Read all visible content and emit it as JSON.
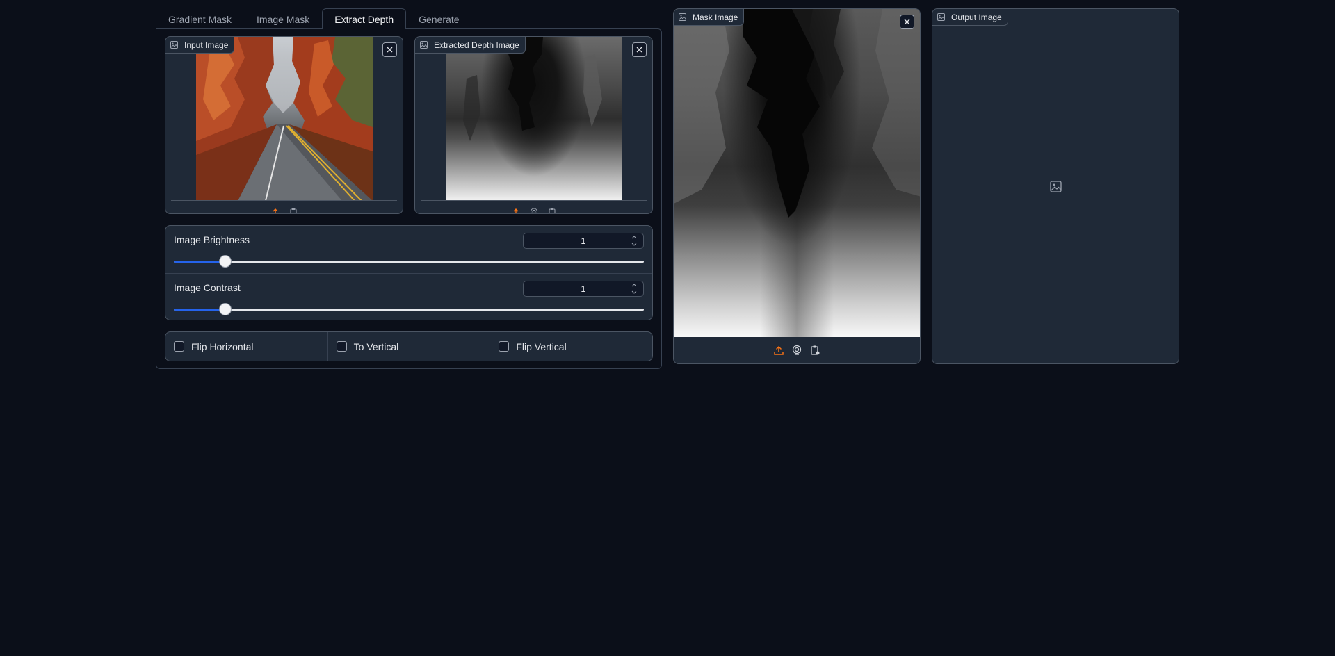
{
  "tabs": [
    {
      "label": "Gradient Mask",
      "active": false
    },
    {
      "label": "Image Mask",
      "active": false
    },
    {
      "label": "Extract Depth",
      "active": true
    },
    {
      "label": "Generate",
      "active": false
    }
  ],
  "input_image": {
    "label": "Input Image",
    "icon": "image-icon"
  },
  "extracted_depth": {
    "label": "Extracted Depth Image",
    "icon": "image-icon"
  },
  "mask_image": {
    "label": "Mask Image",
    "icon": "image-icon"
  },
  "output_image": {
    "label": "Output Image",
    "icon": "image-icon",
    "placeholder_icon": "image-placeholder-icon"
  },
  "sliders": {
    "brightness": {
      "label": "Image Brightness",
      "value": "1",
      "fraction": 0.11
    },
    "contrast": {
      "label": "Image Contrast",
      "value": "1",
      "fraction": 0.11
    }
  },
  "checkboxes": [
    {
      "label": "Flip Horizontal",
      "checked": false
    },
    {
      "label": "To Vertical",
      "checked": false
    },
    {
      "label": "Flip Vertical",
      "checked": false
    }
  ],
  "colors": {
    "background": "#0b0f19",
    "panel": "#1f2937",
    "accent": "#2563eb",
    "upload_icon": "#f97316"
  }
}
